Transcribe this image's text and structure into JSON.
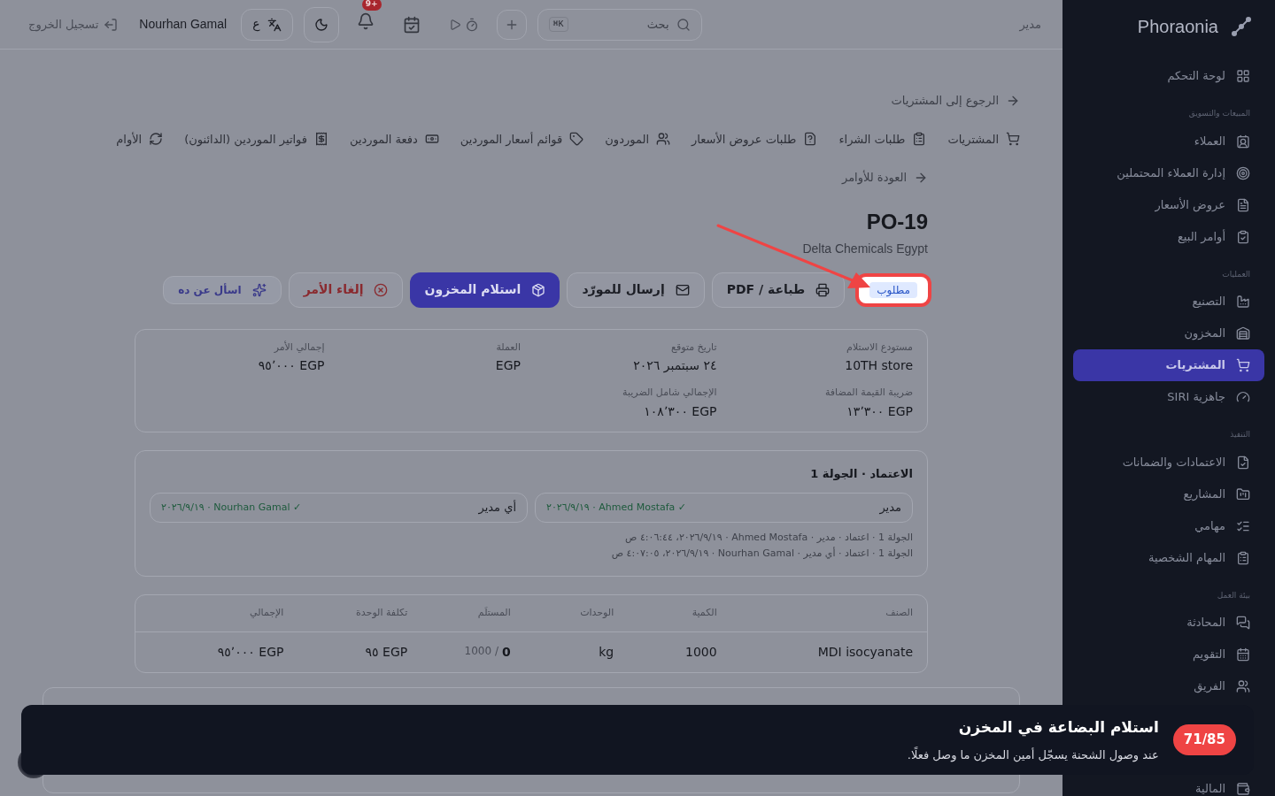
{
  "sidebar": {
    "brand": "Phoraonia",
    "sections": [
      {
        "items": [
          {
            "label": "لوحة التحكم",
            "selected": false
          }
        ]
      },
      {
        "title": "المبيعات والتسويق",
        "items": [
          {
            "label": "العملاء",
            "selected": false
          },
          {
            "label": "إدارة العملاء المحتملين",
            "selected": false
          },
          {
            "label": "عروض الأسعار",
            "selected": false
          },
          {
            "label": "أوامر البيع",
            "selected": false
          }
        ]
      },
      {
        "title": "العمليات",
        "items": [
          {
            "label": "التصنيع",
            "selected": false
          },
          {
            "label": "المخزون",
            "selected": false
          },
          {
            "label": "المشتريات",
            "selected": true
          },
          {
            "label": "جاهزية SIRI",
            "selected": false
          }
        ]
      },
      {
        "title": "التنفيذ",
        "items": [
          {
            "label": "الاعتمادات والضمانات",
            "selected": false
          },
          {
            "label": "المشاريع",
            "selected": false
          },
          {
            "label": "مهامي",
            "selected": false
          },
          {
            "label": "المهام الشخصية",
            "selected": false
          }
        ]
      },
      {
        "title": "بيئة العمل",
        "items": [
          {
            "label": "المحادثة",
            "selected": false
          },
          {
            "label": "التقويم",
            "selected": false
          },
          {
            "label": "الفريق",
            "selected": false
          },
          {
            "label": "المالية",
            "selected": false
          }
        ]
      }
    ]
  },
  "topbar": {
    "role": "مدير",
    "search": {
      "placeholder": "بحث",
      "shortcut": "K⌘"
    },
    "notifications": "+9",
    "language": "ع",
    "user": "Nourhan Gamal",
    "logout": "تسجيل الخروج"
  },
  "back_link": "الرجوع إلى المشتريات",
  "tabs": [
    {
      "label": "المشتريات"
    },
    {
      "label": "طلبات الشراء"
    },
    {
      "label": "طلبات عروض الأسعار"
    },
    {
      "label": "الموردون"
    },
    {
      "label": "قوائم أسعار الموردين"
    },
    {
      "label": "دفعة الموردين"
    },
    {
      "label": "فواتير الموردين (الدائنون)"
    },
    {
      "label": "الأوام"
    }
  ],
  "orders_link": "العودة للأوامر",
  "order": {
    "number": "PO-19",
    "supplier": "Delta Chemicals Egypt",
    "status": "مطلوب",
    "highlighted": true
  },
  "actions": [
    {
      "label": "طباعة / PDF",
      "kind": "default"
    },
    {
      "label": "إرسال للمورّد",
      "kind": "default"
    },
    {
      "label": "استلام المخزون",
      "kind": "primary"
    },
    {
      "label": "إلغاء الأمر",
      "kind": "danger"
    },
    {
      "label": "اسأل عن ده",
      "kind": "ai"
    }
  ],
  "details": [
    {
      "label": "مستودع الاستلام",
      "value": "10TH store"
    },
    {
      "label": "تاريخ متوقع",
      "value": "٢٤ سبتمبر ٢٠٢٦"
    },
    {
      "label": "العملة",
      "value": "EGP"
    },
    {
      "label": "إجمالي الأمر",
      "value": "EGP ٩٥٬٠٠٠"
    },
    {
      "label": "ضريبة القيمة المضافة",
      "value": "EGP ١٣٬٣٠٠"
    },
    {
      "label": "الإجمالي شامل الضريبة",
      "value": "EGP ١٠٨٬٣٠٠"
    }
  ],
  "approvals": {
    "title": "الاعتماد · الجولة 1",
    "slots": [
      {
        "role": "مدير",
        "signed": "✓ Ahmed Mostafa · ٢٠٢٦/٩/١٩"
      },
      {
        "role": "أي مدير",
        "signed": "✓ Nourhan Gamal · ٢٠٢٦/٩/١٩"
      }
    ],
    "log": [
      "الجولة 1 · اعتماد · مدير · Ahmed Mostafa · ٢٠٢٦/٩/١٩، ٤:٠٦:٤٤ ص",
      "الجولة 1 · اعتماد · أي مدير · Nourhan Gamal · ٢٠٢٦/٩/١٩، ٤:٠٧:٠٥ ص"
    ]
  },
  "table": {
    "columns": [
      "الصنف",
      "الكمية",
      "الوحدات",
      "المستلَم",
      "تكلفة الوحدة",
      "الإجمالي"
    ],
    "rows": [
      {
        "item": "MDI isocyanate",
        "quantity": "1000",
        "unit": "kg",
        "received": "0",
        "ordered": "1000 /",
        "unit_cost": "EGP ٩٥",
        "total": "EGP ٩٥٬٠٠٠"
      }
    ]
  },
  "tour": {
    "step": "71/85",
    "title": "استلام البضاعة في المخزن",
    "text": "عند وصول الشحنة يسجّل أمين المخزن ما وصل فعلًا."
  }
}
